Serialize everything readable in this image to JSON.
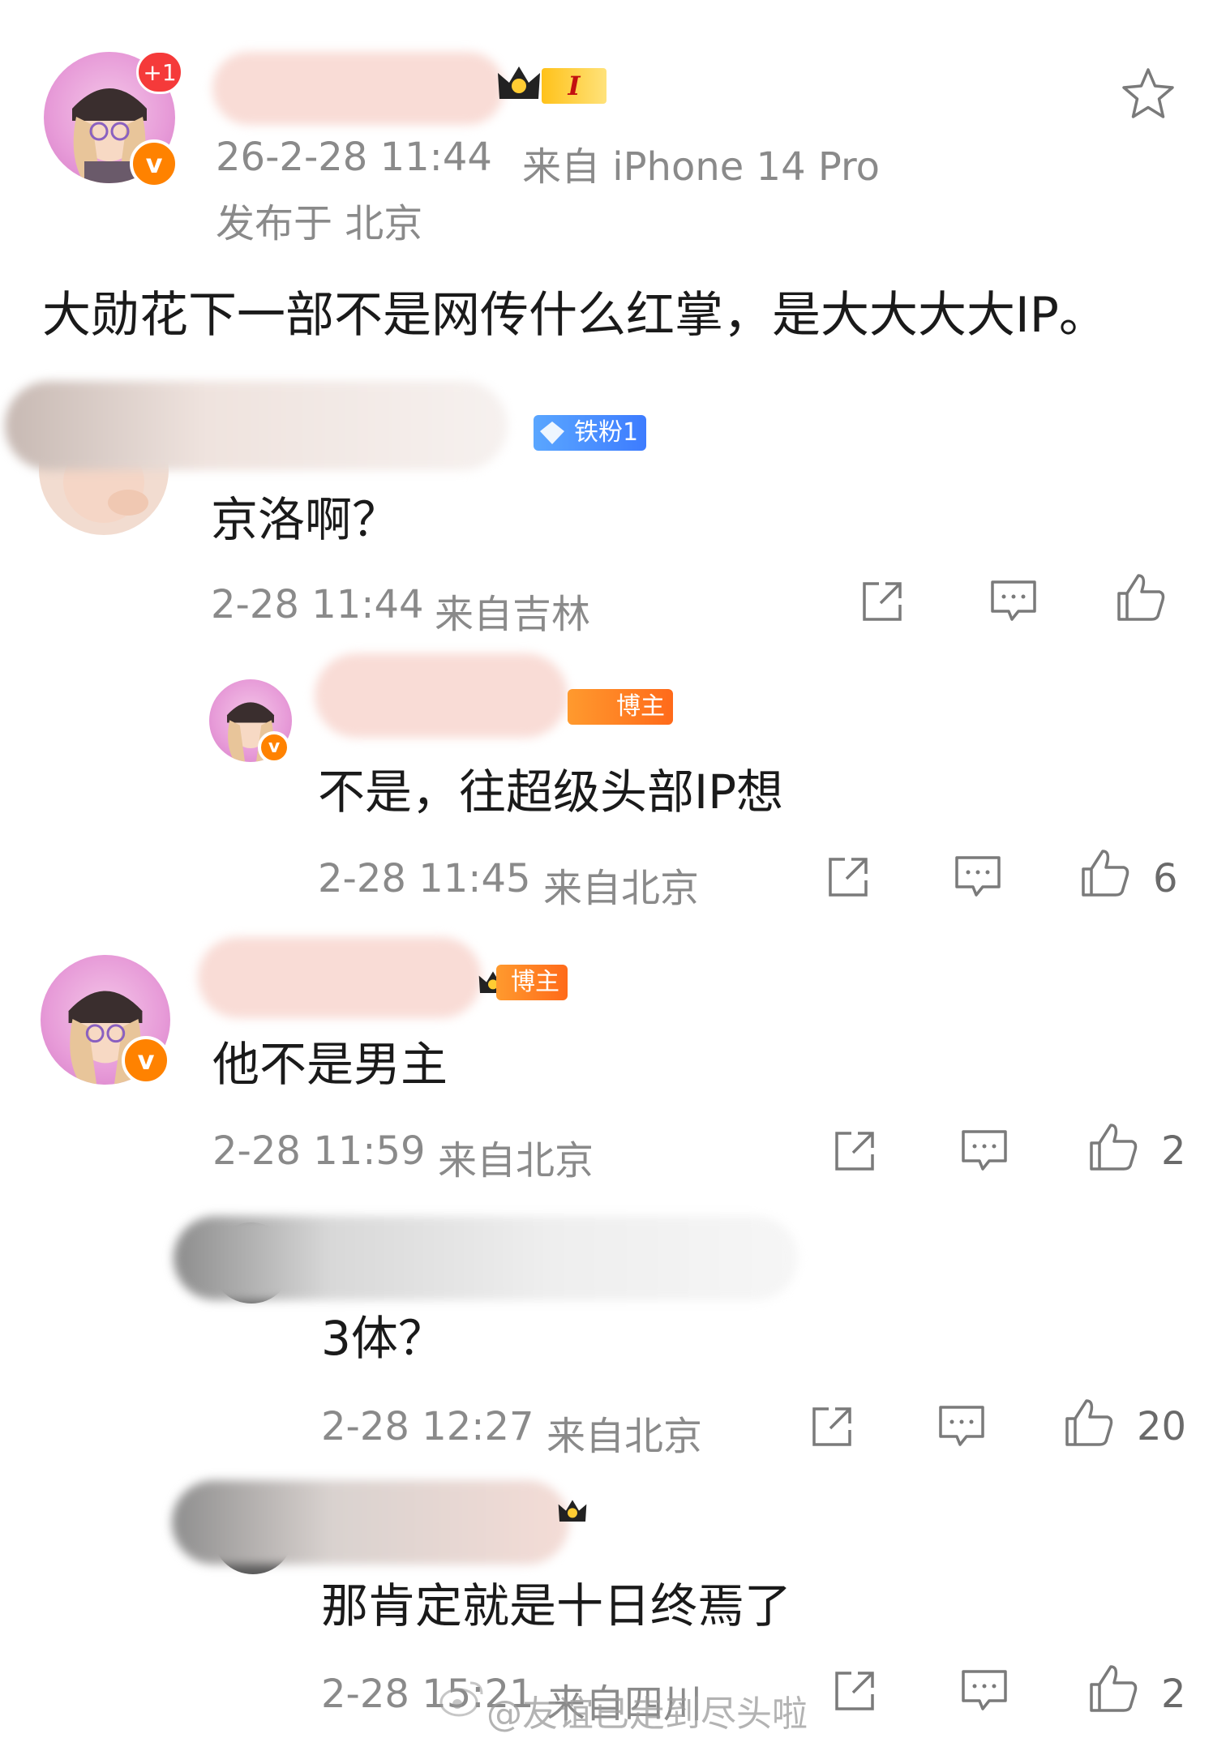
{
  "post": {
    "notification_badge": "+1",
    "verified_badge": "v",
    "level_badge": "I",
    "timestamp": "26-2-28 11:44",
    "source": "来自 iPhone 14 Pro",
    "location": "发布于 北京",
    "text": "大勋花下一部不是网传什么红掌，是大大大大IP。",
    "star_icon": "star-icon"
  },
  "comments": [
    {
      "badge": "铁粉1",
      "text": "京洛啊？",
      "timestamp": "2-28 11:44",
      "source": "来自吉林",
      "likes": ""
    },
    {
      "badge": "博主",
      "text": "不是，往超级头部IP想",
      "timestamp": "2-28 11:45",
      "source": "来自北京",
      "likes": "6"
    },
    {
      "badge": "博主",
      "text": "他不是男主",
      "timestamp": "2-28 11:59",
      "source": "来自北京",
      "likes": "2"
    },
    {
      "badge": "",
      "text": "3体？",
      "timestamp": "2-28 12:27",
      "source": "来自北京",
      "likes": "20"
    },
    {
      "badge": "",
      "text": "那肯定就是十日终焉了",
      "timestamp": "2-28 15:21",
      "source": "来自四川",
      "likes": "2"
    }
  ],
  "watermark": "@友谊已走到尽头啦",
  "colors": {
    "orange": "#ff8200",
    "text": "#1a1a1a",
    "meta": "#8a8a8a",
    "icon": "#7a7a7a",
    "red": "#f53a3a"
  }
}
